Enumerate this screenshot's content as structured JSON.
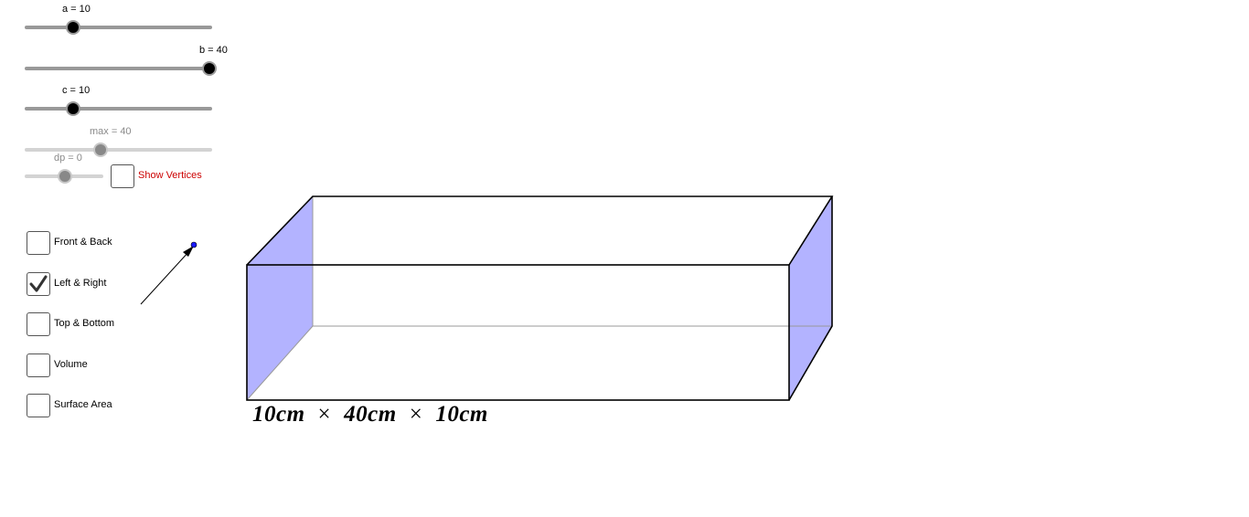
{
  "sliders": {
    "a": {
      "label": "a = 10",
      "value": 10,
      "min": 0,
      "max": 40
    },
    "b": {
      "label": "b = 40",
      "value": 40,
      "min": 0,
      "max": 40
    },
    "c": {
      "label": "c = 10",
      "value": 10,
      "min": 0,
      "max": 40
    },
    "max": {
      "label": "max = 40",
      "value": 40,
      "min": 0,
      "max": 100
    },
    "dp": {
      "label": "dp = 0",
      "value": 0,
      "min": -1,
      "max": 1
    }
  },
  "checkboxes": {
    "show_vertices": {
      "label": "Show Vertices",
      "checked": false
    },
    "front_back": {
      "label": "Front & Back",
      "checked": false
    },
    "left_right": {
      "label": "Left & Right",
      "checked": true
    },
    "top_bottom": {
      "label": "Top & Bottom",
      "checked": false
    },
    "volume": {
      "label": "Volume",
      "checked": false
    },
    "surface_area": {
      "label": "Surface Area",
      "checked": false
    }
  },
  "dimensions": {
    "a": "10cm",
    "b": "40cm",
    "c": "10cm",
    "times": "×"
  },
  "colors": {
    "face_fill": "#b3b3ff",
    "edge": "#000000",
    "hidden_edge": "#999999",
    "vector_point": "#1a1aff"
  }
}
